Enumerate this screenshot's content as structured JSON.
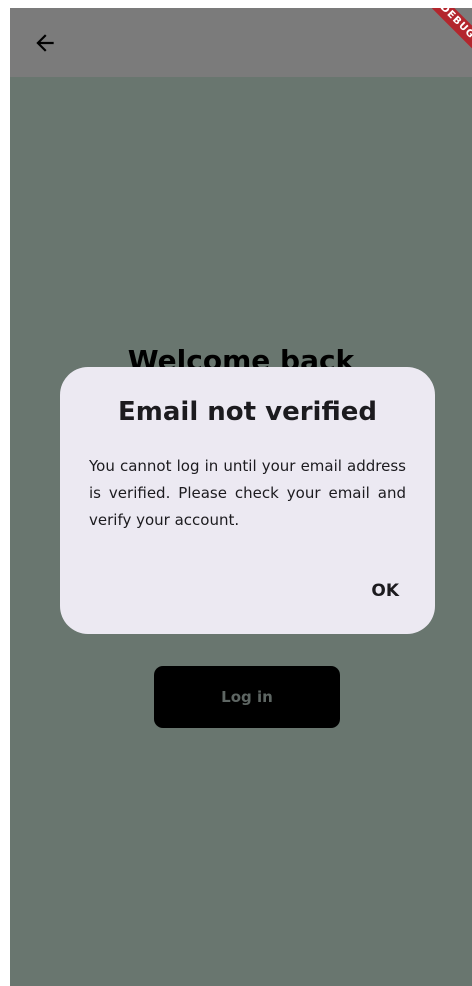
{
  "app_bar": {
    "back_icon": "arrow-left-icon",
    "debug_banner": "DEBUG"
  },
  "login": {
    "title": "Welcome back",
    "login_button_label": "Log in"
  },
  "dialog": {
    "title": "Email not verified",
    "message": "You cannot log in until your email address is verified. Please check your email and verify your account.",
    "ok_label": "OK"
  },
  "colors": {
    "background": "#69766f",
    "app_bar": "#7b7b7b",
    "dialog_surface": "#ece9f2",
    "button_bg": "#000000",
    "banner": "#b3262d"
  }
}
